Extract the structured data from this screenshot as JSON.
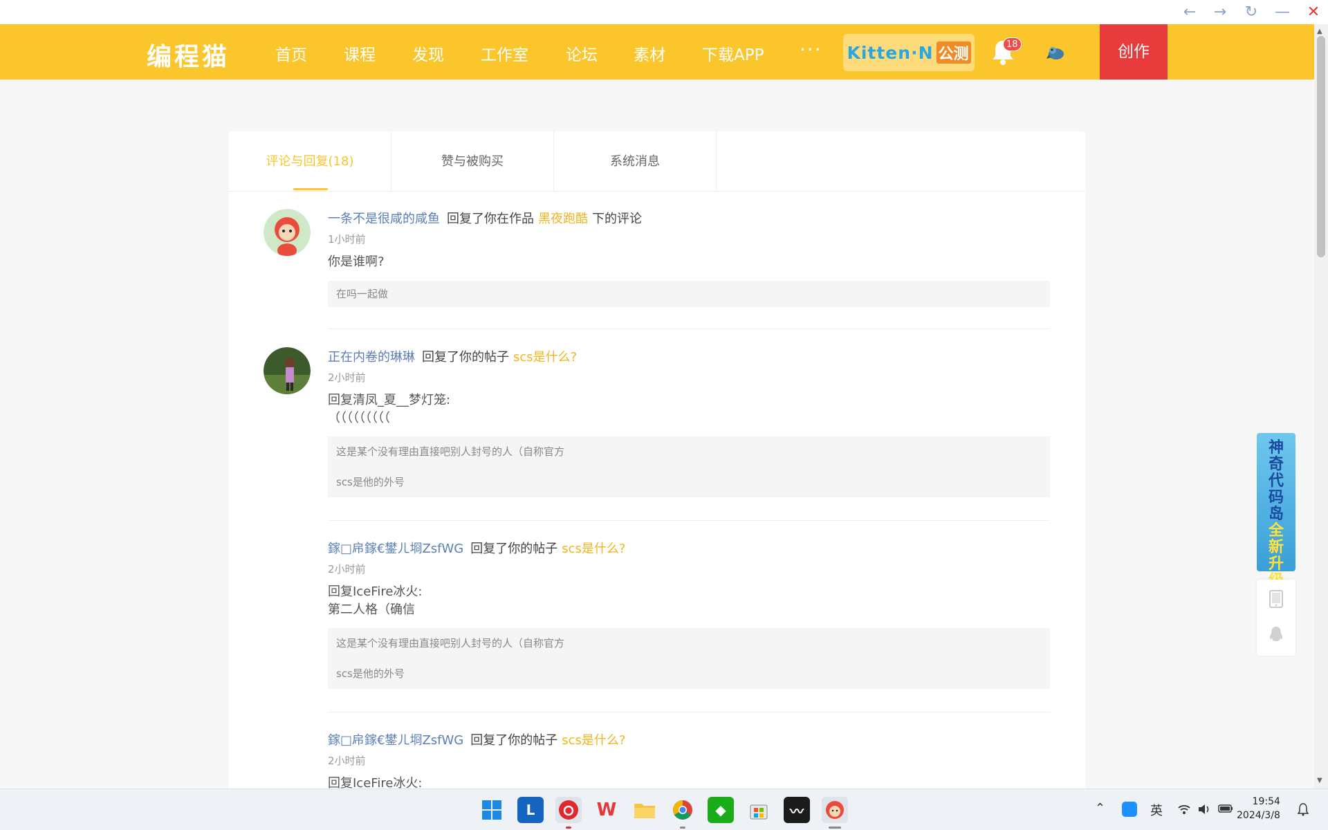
{
  "window": {
    "back_icon": "←",
    "forward_icon": "→",
    "reload_icon": "↻",
    "minimize_icon": "—",
    "close_icon": "✕"
  },
  "header": {
    "logo": "编程猫",
    "nav": [
      "首页",
      "课程",
      "发现",
      "工作室",
      "论坛",
      "素材",
      "下载APP"
    ],
    "more": "···",
    "kitten_label": "Kitten·N",
    "kitten_tag": "公测",
    "notification_count": "18",
    "create_label": "创作"
  },
  "tabs": [
    {
      "label": "评论与回复(18)",
      "active": true
    },
    {
      "label": "赞与被购买",
      "active": false
    },
    {
      "label": "系统消息",
      "active": false
    }
  ],
  "messages": [
    {
      "user": "一条不是很咸的咸鱼",
      "action": "回复了你在作品",
      "target": "黑夜跑酷",
      "suffix": "下的评论",
      "time": "1小时前",
      "body": "你是谁啊?",
      "quote": [
        "在吗一起做"
      ]
    },
    {
      "user": "正在内卷的琳琳",
      "action": "回复了你的帖子",
      "target": "scs是什么?",
      "suffix": "",
      "time": "2小时前",
      "body": "回复清凤_夏__梦灯笼:\n（（（（（（（（（",
      "quote": [
        "这是某个没有理由直接吧别人封号的人（自称官方",
        "scs是他的外号"
      ]
    },
    {
      "user": "鎵□帍鎵€鐢ㄦ埛ZsfWG",
      "action": "回复了你的帖子",
      "target": "scs是什么?",
      "suffix": "",
      "time": "2小时前",
      "body": "回复IceFire冰火:\n第二人格（确信",
      "quote": [
        "这是某个没有理由直接吧别人封号的人（自称官方",
        "scs是他的外号"
      ]
    },
    {
      "user": "鎵□帍鎵€鐢ㄦ埛ZsfWG",
      "action": "回复了你的帖子",
      "target": "scs是什么?",
      "suffix": "",
      "time": "2小时前",
      "body": "回复IceFire冰火:",
      "quote": []
    }
  ],
  "side_banner": {
    "line1": "神奇代码岛",
    "line2": "全新升级"
  },
  "taskbar": {
    "apps": [
      "windows-start",
      "security-app",
      "netease-music",
      "wps-office",
      "file-explorer",
      "chrome",
      "wechat-store",
      "microsoft-store",
      "dark-app",
      "codemao-app"
    ],
    "ime": "英",
    "time": "19:54",
    "date": "2024/3/8"
  },
  "colors": {
    "brand_yellow": "#fbc52c",
    "create_red": "#e83b3b",
    "user_link": "#5a7eb5",
    "target_link": "#f3b31d"
  }
}
